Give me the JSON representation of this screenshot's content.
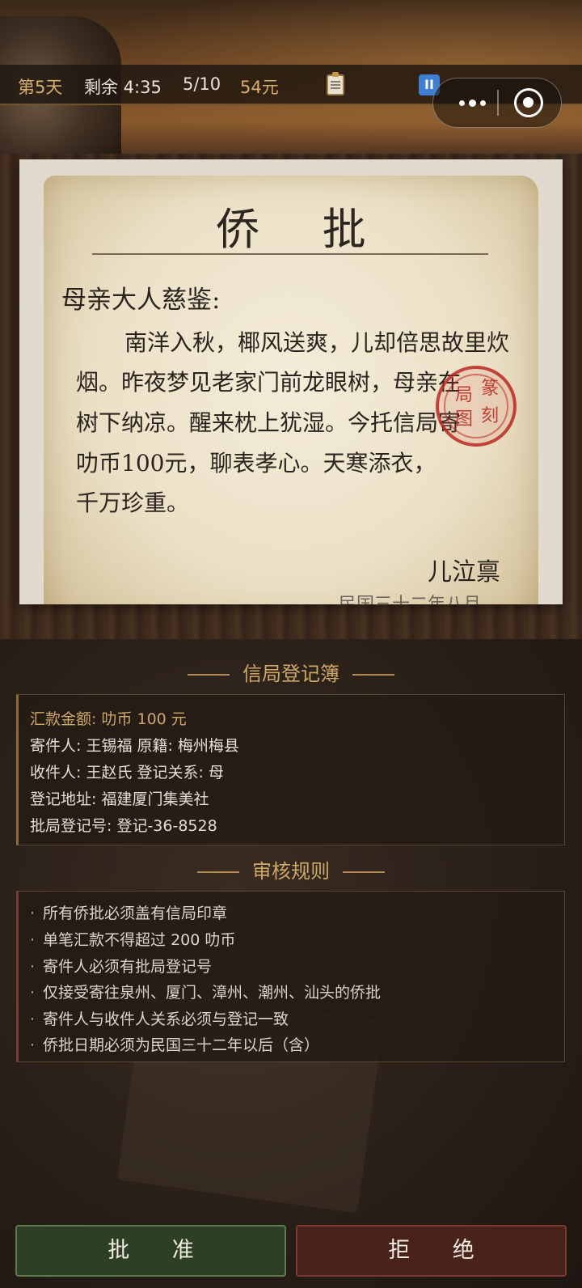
{
  "status": {
    "day": "第5天",
    "time_left": "剩余 4:35",
    "progress": "5/10",
    "money": "54元"
  },
  "icons": {
    "clipboard": "clipboard-icon",
    "pause": "pause-icon",
    "more": "more-dots-icon",
    "close": "close-target-icon"
  },
  "pause_label": "II",
  "letter": {
    "title": "侨 批",
    "salutation": "母亲大人慈鉴:",
    "lines": [
      "南洋入秋，椰风送爽，儿却倍思故里炊",
      "烟。昨夜梦见老家门前龙眼树，母亲在",
      "树下纳凉。醒来枕上犹湿。今托信局寄",
      "叻币100元，聊表孝心。天寒添衣，",
      "千万珍重。"
    ],
    "signature": "儿泣禀",
    "date_partial": "民国三十二年八月",
    "seal_text": [
      "篆",
      "刻",
      "局",
      "图"
    ]
  },
  "register": {
    "heading": "信局登记簿",
    "amount": "汇款金额: 叻币 100 元",
    "sender": "寄件人: 王锡福  原籍: 梅州梅县",
    "recipient": "收件人: 王赵氏  登记关系: 母",
    "address": "登记地址: 福建厦门集美社",
    "reg_no": "批局登记号: 登记-36-8528"
  },
  "rules": {
    "heading": "审核规则",
    "items": [
      "所有侨批必须盖有信局印章",
      "单笔汇款不得超过 200 叻币",
      "寄件人必须有批局登记号",
      "仅接受寄往泉州、厦门、漳州、潮州、汕头的侨批",
      "寄件人与收件人关系必须与登记一致",
      "侨批日期必须为民国三十二年以后（含）"
    ]
  },
  "actions": {
    "approve": "批 准",
    "reject": "拒 绝"
  },
  "colors": {
    "accent_gold": "#cfa766",
    "approve_green": "#2d3f25",
    "reject_red": "#4a221c",
    "seal_red": "#b9231e"
  }
}
